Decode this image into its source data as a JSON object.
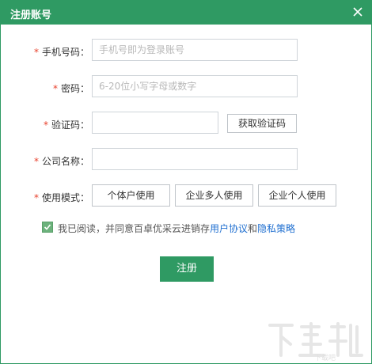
{
  "window": {
    "title": "注册账号"
  },
  "form": {
    "phone": {
      "label": "手机号码：",
      "placeholder": "手机号即为登录账号"
    },
    "password": {
      "label": "密码：",
      "placeholder": "6-20位小写字母或数字"
    },
    "code": {
      "label": "验证码：",
      "placeholder": "",
      "send_button": "获取验证码"
    },
    "company": {
      "label": "公司名称：",
      "placeholder": ""
    },
    "mode": {
      "label": "使用模式：",
      "options": [
        "个体户使用",
        "企业多人使用",
        "企业个人使用"
      ]
    },
    "required_mark": "*"
  },
  "agreement": {
    "text": "我已阅读，并同意百卓优采云进销存",
    "link1": "用户协议",
    "and": "和",
    "link2": "隐私策略",
    "checked": true
  },
  "actions": {
    "submit": "注册"
  },
  "watermark": {
    "text": "下载吧"
  },
  "colors": {
    "brand": "#2f9a63",
    "required": "#e8412c",
    "link": "#1f6fd0"
  }
}
